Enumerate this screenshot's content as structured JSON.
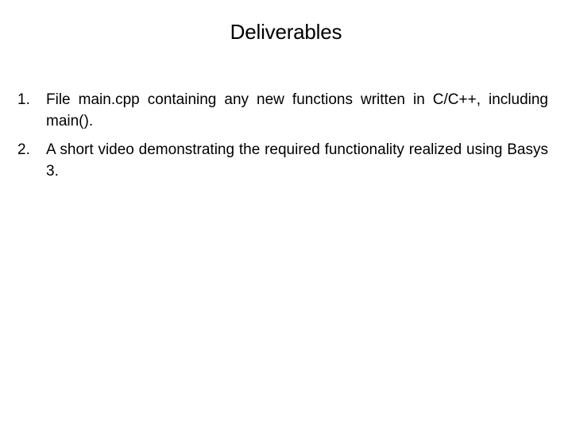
{
  "slide": {
    "title": "Deliverables",
    "background_color": "#ffffff",
    "text_color": "#000000",
    "list": [
      {
        "marker": "1.",
        "text": "File main.cpp containing any new functions written in C/C++, including main()."
      },
      {
        "marker": "2.",
        "text": "A short video demonstrating the required functionality realized using Basys 3."
      }
    ]
  }
}
